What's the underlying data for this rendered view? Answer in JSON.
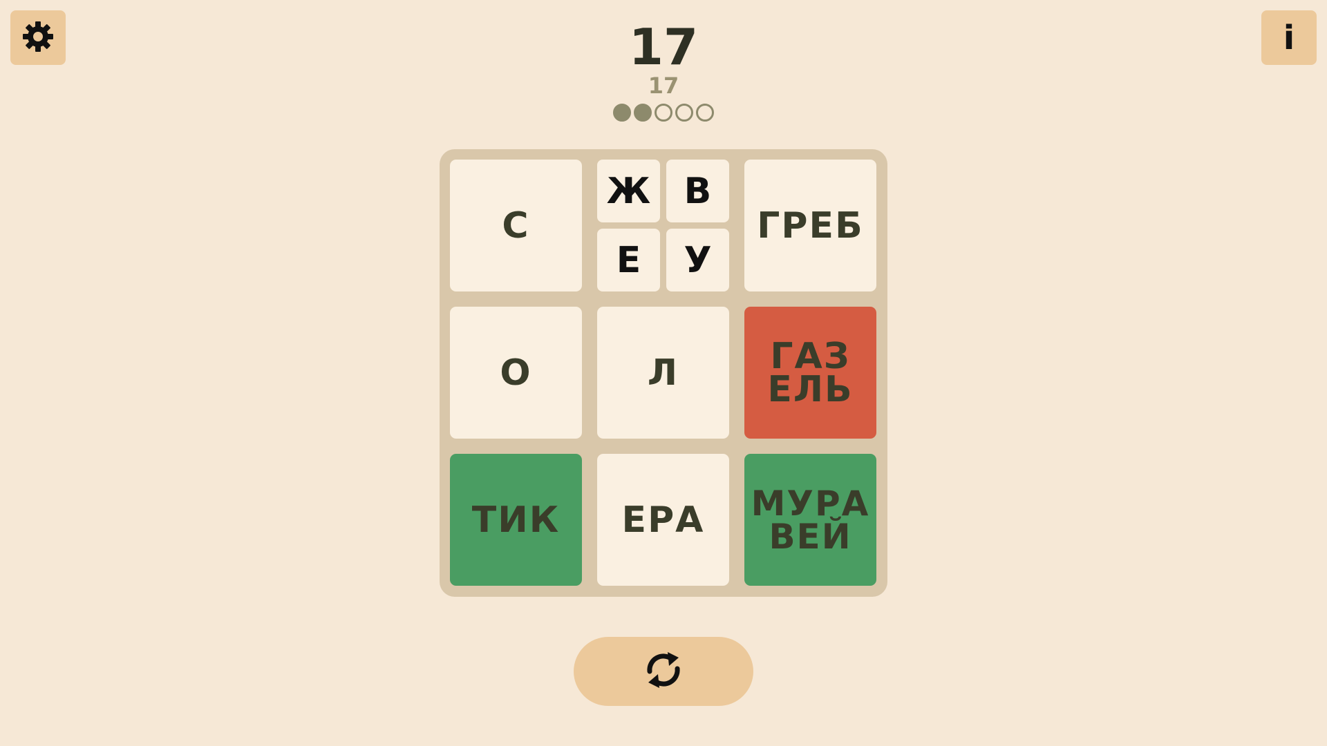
{
  "header": {
    "score": "17",
    "sub_score": "17",
    "progress_dots": {
      "filled": 2,
      "total": 5
    }
  },
  "icons": {
    "settings": "gear-icon",
    "info": "info-icon",
    "refresh": "refresh-icon"
  },
  "info_label": "i",
  "colors": {
    "background": "#f6e8d6",
    "board": "#d9c7aa",
    "tile": "#faf0e1",
    "button": "#ecc99b",
    "tile_red": "#d55c42",
    "tile_green": "#4a9d62",
    "text_dark": "#3a3d2a",
    "dot": "#8d8a6c"
  },
  "board": {
    "tiles": [
      {
        "text": "С",
        "state": "neutral"
      },
      {
        "split": [
          "Ж",
          "В",
          "Е",
          "У"
        ],
        "state": "split"
      },
      {
        "text": "ГРЕБ",
        "state": "neutral"
      },
      {
        "text": "О",
        "state": "neutral"
      },
      {
        "text": "Л",
        "state": "neutral"
      },
      {
        "text": "ГАЗЕЛЬ",
        "state": "red"
      },
      {
        "text": "ТИК",
        "state": "green"
      },
      {
        "text": "ЕРА",
        "state": "neutral"
      },
      {
        "text": "МУРАВЕЙ",
        "state": "green"
      }
    ]
  }
}
